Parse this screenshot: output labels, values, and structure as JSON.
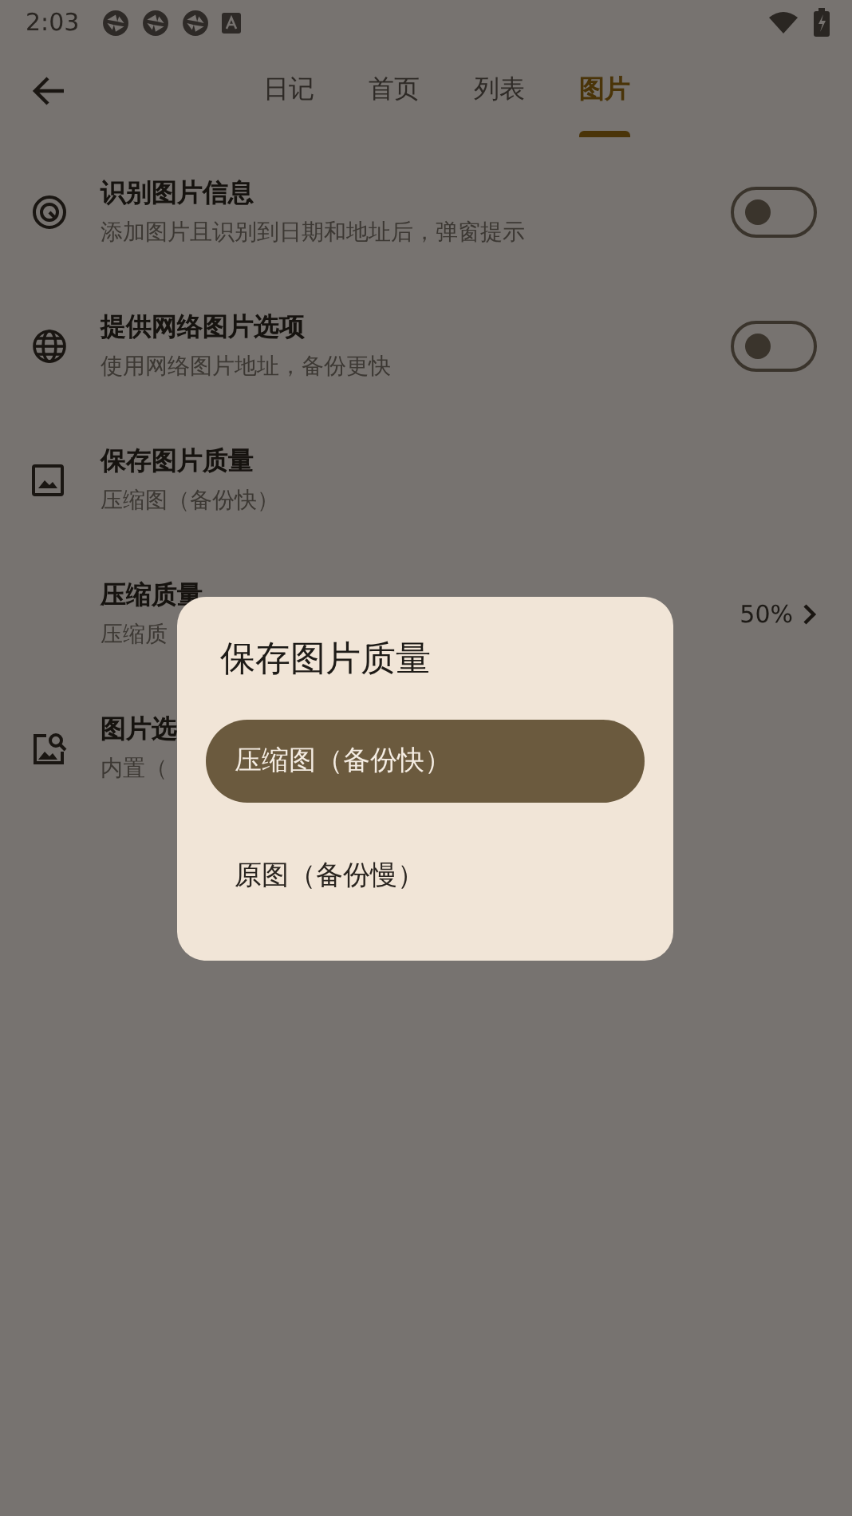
{
  "status_bar": {
    "time": "2:03"
  },
  "tabs": [
    {
      "label": "日记",
      "selected": false
    },
    {
      "label": "首页",
      "selected": false
    },
    {
      "label": "列表",
      "selected": false
    },
    {
      "label": "图片",
      "selected": true
    }
  ],
  "settings": [
    {
      "kind": "toggle",
      "title": "识别图片信息",
      "subtitle": "添加图片且识别到日期和地址后，弹窗提示",
      "on": false
    },
    {
      "kind": "toggle",
      "title": "提供网络图片选项",
      "subtitle": "使用网络图片地址，备份更快",
      "on": false
    },
    {
      "kind": "plain",
      "title": "保存图片质量",
      "subtitle": "压缩图（备份快）"
    },
    {
      "kind": "value",
      "title": "压缩质量",
      "subtitle": "压缩质",
      "value": "50%"
    },
    {
      "kind": "plain",
      "title": "图片选",
      "subtitle": "内置（"
    }
  ],
  "dialog": {
    "title": "保存图片质量",
    "options": [
      {
        "label": "压缩图（备份快）",
        "selected": true
      },
      {
        "label": "原图（备份慢）",
        "selected": false
      }
    ]
  }
}
